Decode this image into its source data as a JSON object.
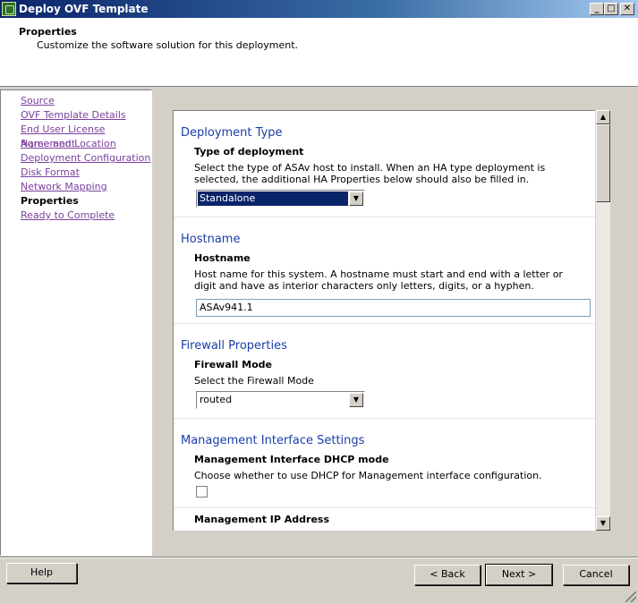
{
  "window": {
    "title": "Deploy OVF Template",
    "controls": {
      "minimize": "_",
      "maximize": "□",
      "close": "✕"
    }
  },
  "header": {
    "title": "Properties",
    "subtitle": "Customize the software solution for this deployment."
  },
  "nav": {
    "items": [
      {
        "label": "Source"
      },
      {
        "label": "OVF Template Details"
      },
      {
        "label": "End User License Agreement"
      },
      {
        "label": "Name and Location"
      },
      {
        "label": "Deployment Configuration"
      },
      {
        "label": "Disk Format"
      },
      {
        "label": "Network Mapping"
      },
      {
        "label": "Properties"
      },
      {
        "label": "Ready to Complete"
      }
    ],
    "active": "Properties"
  },
  "sections": {
    "deployment": {
      "title": "Deployment Type",
      "field_label": "Type of deployment",
      "description": "Select the type of ASAv host to install. When an HA type deployment is selected, the additional HA Properties below should also be filled in.",
      "value": "Standalone"
    },
    "hostname": {
      "title": "Hostname",
      "field_label": "Hostname",
      "description": "Host name for this system. A hostname must start and end with a letter or digit and have as interior characters only letters, digits, or a hyphen.",
      "value": "ASAv941.1"
    },
    "firewall": {
      "title": "Firewall Properties",
      "field_label": "Firewall Mode",
      "description": "Select the Firewall Mode",
      "value": "routed"
    },
    "management": {
      "title": "Management Interface Settings",
      "dhcp_label": "Management Interface DHCP mode",
      "dhcp_description": "Choose whether to use DHCP for Management interface configuration.",
      "dhcp_checked": false,
      "ip_label": "Management IP Address"
    }
  },
  "footer": {
    "help": "Help",
    "back": "< Back",
    "next": "Next >",
    "cancel": "Cancel"
  },
  "colors": {
    "section_title": "#1a3ea8",
    "nav_link": "#7b3f9e",
    "selection": "#0a246a"
  }
}
